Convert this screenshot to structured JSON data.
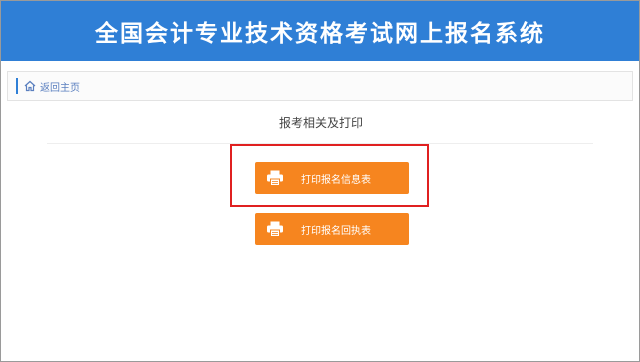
{
  "header": {
    "title": "全国会计专业技术资格考试网上报名系统"
  },
  "breadcrumb": {
    "home_label": "返回主页"
  },
  "main": {
    "section_title": "报考相关及打印",
    "buttons": [
      {
        "label": "打印报名信息表",
        "icon": "printer-icon"
      },
      {
        "label": "打印报名回执表",
        "icon": "printer-icon"
      }
    ]
  },
  "colors": {
    "header_bg": "#2f7fd6",
    "button_bg": "#f6851f",
    "highlight_border": "#e02020"
  }
}
